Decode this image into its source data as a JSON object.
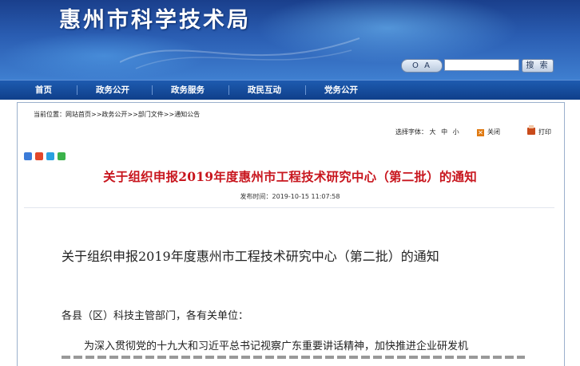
{
  "header": {
    "site_title": "惠州市科学技术局",
    "oa_label": "O A",
    "search": {
      "value": "",
      "placeholder": "",
      "button_label": "搜 索"
    }
  },
  "nav": {
    "items": [
      {
        "label": "首页"
      },
      {
        "label": "政务公开"
      },
      {
        "label": "政务服务"
      },
      {
        "label": "政民互动"
      },
      {
        "label": "党务公开"
      }
    ]
  },
  "breadcrumb": "当前位置：网站首页>>政务公开>>部门文件>>通知公告",
  "tools": {
    "font_label": "选择字体：",
    "font_sizes": [
      "大",
      "中",
      "小"
    ],
    "close_label": "关闭",
    "print_label": "打印"
  },
  "share_icons": [
    "share-qzone-icon",
    "share-weibo-icon",
    "share-qq-icon",
    "share-wechat-icon"
  ],
  "article": {
    "title": "关于组织申报2019年度惠州市工程技术研究中心（第二批）的通知",
    "publish_label": "发布时间：",
    "publish_time": "2019-10-15 11:07:58",
    "body_title": "关于组织申报2019年度惠州市工程技术研究中心（第二批）的通知",
    "salutation": "各县（区）科技主管部门，各有关单位：",
    "paragraph1": "为深入贯彻党的十九大和习近平总书记视察广东重要讲话精神，加快推进企业研发机"
  },
  "colors": {
    "banner": "#2a5db2",
    "nav": "#1e5bb0",
    "title_red": "#c8161e"
  }
}
